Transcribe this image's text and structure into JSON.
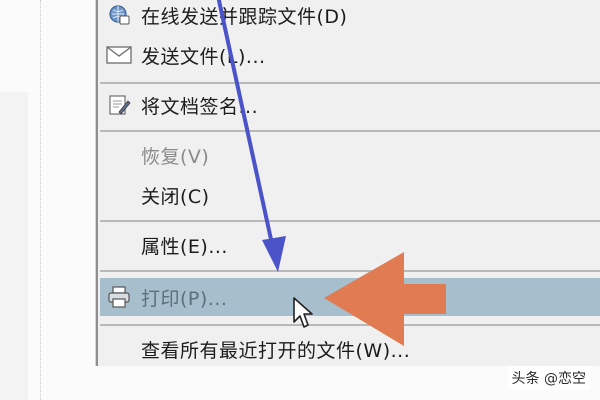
{
  "menu": {
    "items": [
      {
        "label": "在线发送并跟踪文件(D)",
        "icon": "send-track-icon",
        "disabled": false,
        "highlighted": false
      },
      {
        "label": "发送文件(L)...",
        "icon": "envelope-icon",
        "disabled": false,
        "highlighted": false
      },
      {
        "label": "将文档签名...",
        "icon": "sign-document-icon",
        "disabled": false,
        "highlighted": false
      },
      {
        "label": "恢复(V)",
        "icon": "",
        "disabled": true,
        "highlighted": false
      },
      {
        "label": "关闭(C)",
        "icon": "",
        "disabled": false,
        "highlighted": false
      },
      {
        "label": "属性(E)...",
        "icon": "",
        "disabled": false,
        "highlighted": false
      },
      {
        "label": "打印(P)...",
        "icon": "printer-icon",
        "disabled": false,
        "highlighted": true
      },
      {
        "label": "查看所有最近打开的文件(W)...",
        "icon": "",
        "disabled": false,
        "highlighted": false
      }
    ]
  },
  "annotations": {
    "blue_arrow_color": "#4a54c8",
    "orange_arrow_color": "#e07b52",
    "highlight_color": "#a7bfcd"
  },
  "watermark": {
    "text": "头条 @恋空"
  }
}
